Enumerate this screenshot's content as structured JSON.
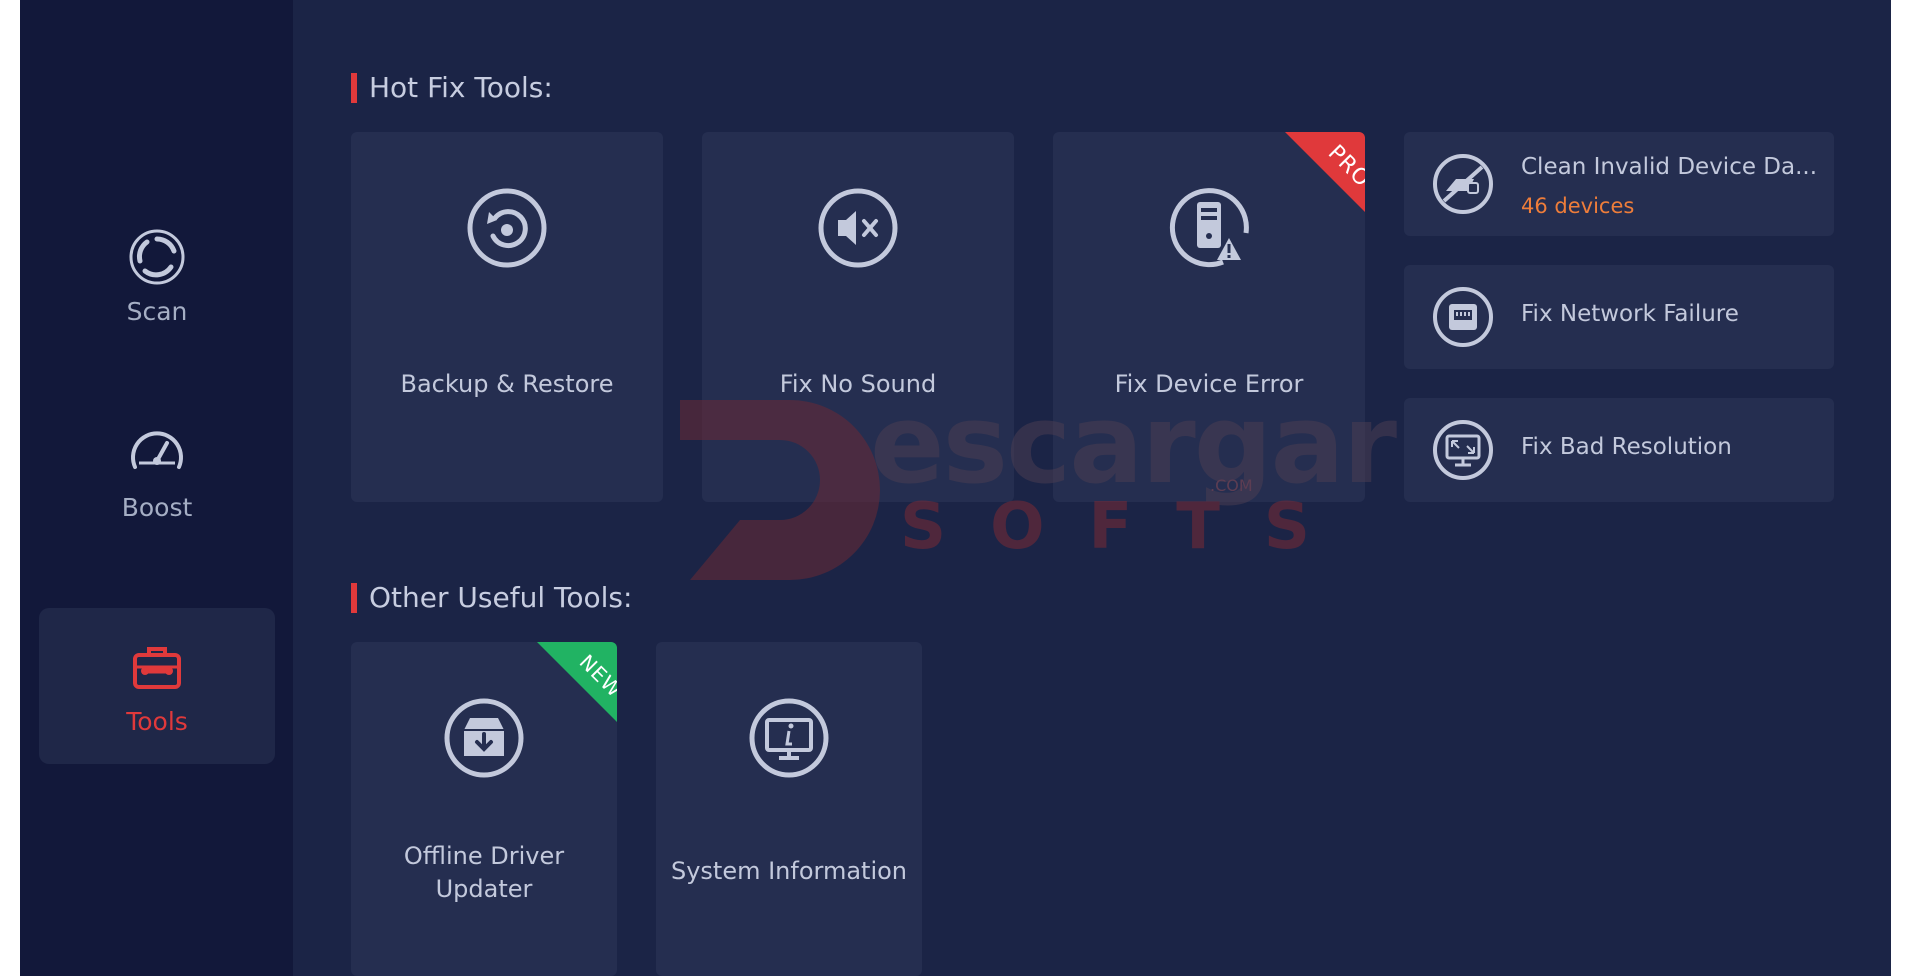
{
  "sidebar": {
    "items": [
      {
        "label": "Scan",
        "icon": "scan-icon",
        "active": false
      },
      {
        "label": "Boost",
        "icon": "speedometer-icon",
        "active": false
      },
      {
        "label": "Tools",
        "icon": "toolbox-icon",
        "active": true
      }
    ]
  },
  "hotfix": {
    "title": "Hot Fix Tools:",
    "cards": [
      {
        "label": "Backup & Restore",
        "icon": "backup-restore-icon"
      },
      {
        "label": "Fix No Sound",
        "icon": "mute-speaker-icon"
      },
      {
        "label": "Fix Device Error",
        "icon": "device-error-icon",
        "ribbon": "PRO"
      }
    ],
    "side_cards": [
      {
        "title": "Clean Invalid Device Da...",
        "subtitle": "46 devices",
        "icon": "clean-device-icon"
      },
      {
        "title": "Fix Network Failure",
        "icon": "network-port-icon"
      },
      {
        "title": "Fix Bad Resolution",
        "icon": "resolution-icon"
      }
    ]
  },
  "other": {
    "title": "Other Useful Tools:",
    "cards": [
      {
        "label_line1": "Offline Driver",
        "label_line2": "Updater",
        "icon": "offline-driver-icon",
        "ribbon": "NEW"
      },
      {
        "label": "System Information",
        "icon": "system-info-icon"
      }
    ]
  },
  "watermark": {
    "line1": "escargar",
    "line2": "SOFTS",
    "suffix": ".COM"
  },
  "colors": {
    "background": "#1b2446",
    "sidebar": "#12183a",
    "card": "#252e50",
    "accent_red": "#e0393b",
    "accent_green": "#21b363",
    "accent_orange": "#ee7d3a",
    "text": "#c3c9dc"
  }
}
